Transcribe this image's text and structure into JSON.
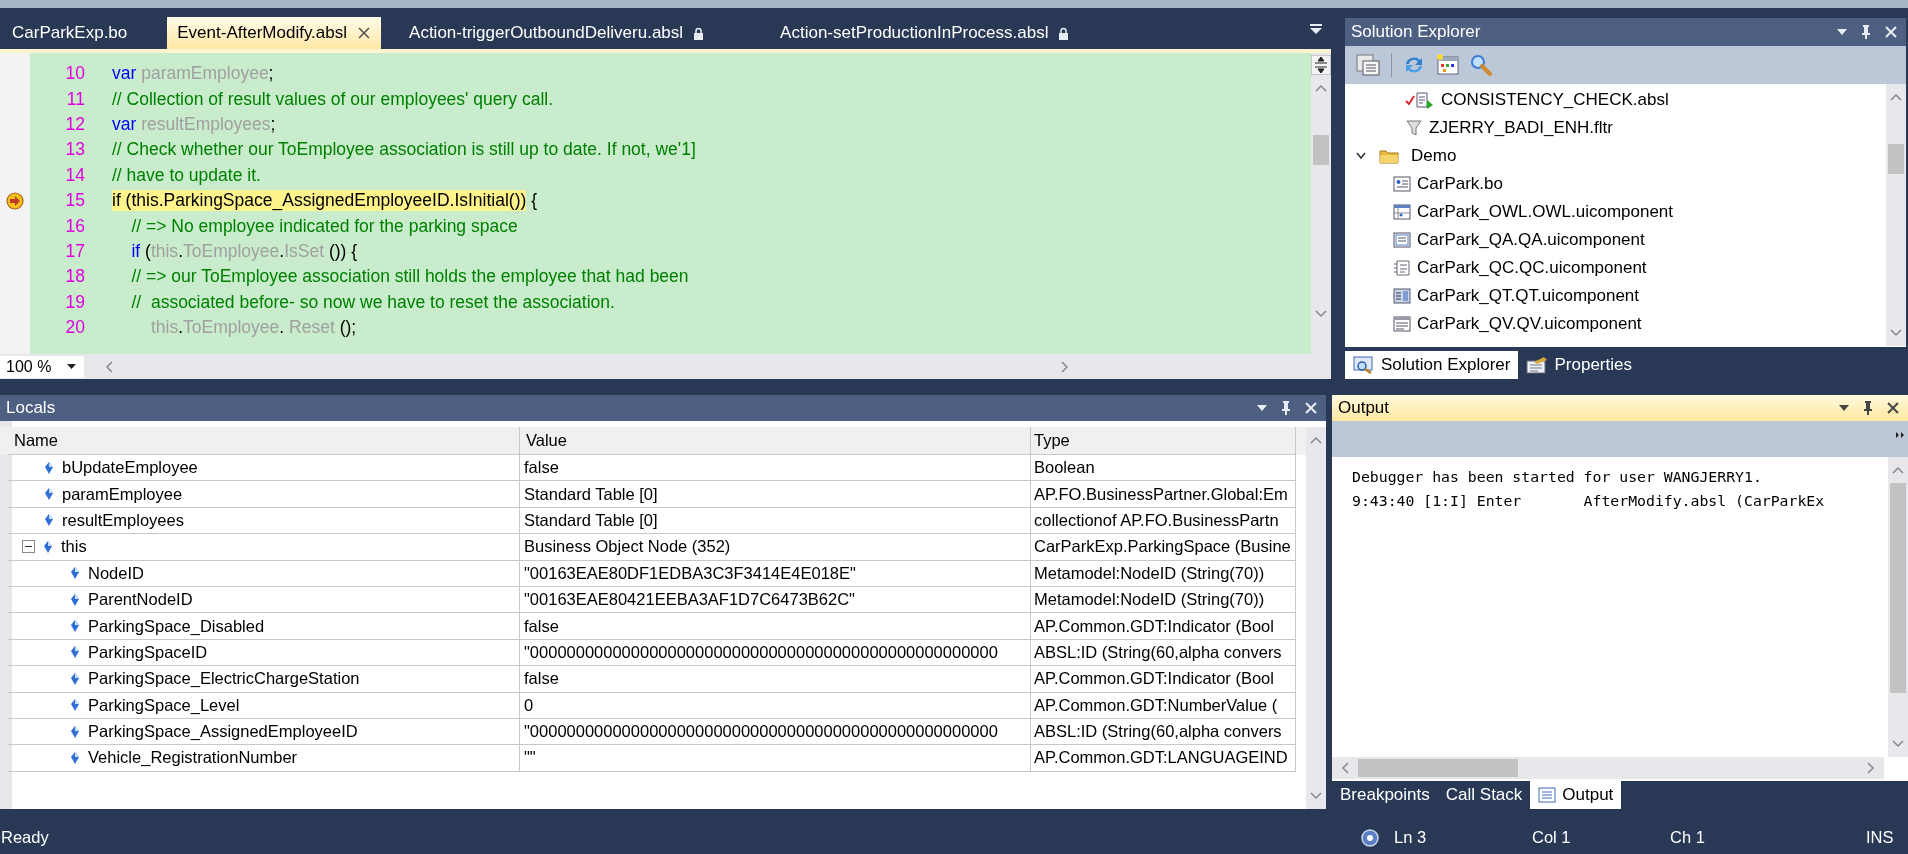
{
  "editor": {
    "tabs": [
      {
        "label": "CarParkExp.bo",
        "selected": false,
        "locked": false,
        "closable": false
      },
      {
        "label": "Event-AfterModify.absl",
        "selected": true,
        "locked": false,
        "closable": true
      },
      {
        "label": "Action-triggerOutboundDeliveru.absl",
        "selected": false,
        "locked": true,
        "closable": false
      },
      {
        "label": "Action-setProductionInProcess.absl",
        "selected": false,
        "locked": true,
        "closable": false
      }
    ],
    "lines": [
      {
        "number": "10",
        "current": false,
        "tokens": [
          {
            "kind": "keyword",
            "text": "var "
          },
          {
            "kind": "ident",
            "text": "paramEmployee"
          },
          {
            "kind": "plain",
            "text": ";"
          }
        ]
      },
      {
        "number": "11",
        "current": false,
        "tokens": [
          {
            "kind": "comment",
            "text": "// Collection of result values of our employees' query call."
          }
        ]
      },
      {
        "number": "12",
        "current": false,
        "tokens": [
          {
            "kind": "keyword",
            "text": "var "
          },
          {
            "kind": "ident",
            "text": "resultEmployees"
          },
          {
            "kind": "plain",
            "text": ";"
          }
        ]
      },
      {
        "number": "13",
        "current": false,
        "tokens": [
          {
            "kind": "comment",
            "text": "// Check whether our ToEmployee association is still up to date. If not, we'1]"
          }
        ]
      },
      {
        "number": "14",
        "current": false,
        "tokens": [
          {
            "kind": "comment",
            "text": "// have to update it."
          }
        ]
      },
      {
        "number": "15",
        "current": true,
        "tokens": [
          {
            "kind": "plain",
            "text": "if (this.ParkingSpace_AssignedEmployeeID.IsInitial())"
          }
        ],
        "tail": " {"
      },
      {
        "number": "16",
        "current": false,
        "tokens": [
          {
            "kind": "comment",
            "text": "    // => No employee indicated for the parking space"
          }
        ]
      },
      {
        "number": "17",
        "current": false,
        "tokens": [
          {
            "kind": "keyword",
            "text": "    if "
          },
          {
            "kind": "plain",
            "text": "("
          },
          {
            "kind": "ident",
            "text": "this"
          },
          {
            "kind": "plain",
            "text": "."
          },
          {
            "kind": "ident",
            "text": "ToEmployee"
          },
          {
            "kind": "plain",
            "text": "."
          },
          {
            "kind": "ident",
            "text": "IsSet"
          },
          {
            "kind": "plain",
            "text": " ()) {"
          }
        ]
      },
      {
        "number": "18",
        "current": false,
        "tokens": [
          {
            "kind": "comment",
            "text": "    // => our ToEmployee association still holds the employee that had been"
          }
        ]
      },
      {
        "number": "19",
        "current": false,
        "tokens": [
          {
            "kind": "comment",
            "text": "    //  associated before- so now we have to reset the association."
          }
        ]
      },
      {
        "number": "20",
        "current": false,
        "tokens": [
          {
            "kind": "ident",
            "text": "        this"
          },
          {
            "kind": "plain",
            "text": "."
          },
          {
            "kind": "ident",
            "text": "ToEmployee"
          },
          {
            "kind": "plain",
            "text": ". "
          },
          {
            "kind": "ident",
            "text": "Reset"
          },
          {
            "kind": "plain",
            "text": " ();"
          }
        ]
      }
    ],
    "zoom": "100 %"
  },
  "solution_explorer": {
    "title": "Solution Explorer",
    "tree": [
      {
        "label": "CONSISTENCY_CHECK.absl",
        "kind": "checked-script"
      },
      {
        "label": "ZJERRY_BADI_ENH.fltr",
        "kind": "filter"
      },
      {
        "label": "Demo",
        "kind": "folder",
        "expanded": true,
        "children": [
          {
            "label": "CarPark.bo",
            "kind": "bo"
          },
          {
            "label": "CarPark_OWL.OWL.uicomponent",
            "kind": "owl"
          },
          {
            "label": "CarPark_QA.QA.uicomponent",
            "kind": "qa"
          },
          {
            "label": "CarPark_QC.QC.uicomponent",
            "kind": "qc"
          },
          {
            "label": "CarPark_QT.QT.uicomponent",
            "kind": "qt"
          },
          {
            "label": "CarPark_QV.QV.uicomponent",
            "kind": "qv"
          }
        ]
      }
    ],
    "tabs": [
      {
        "label": "Solution Explorer",
        "selected": true,
        "kind": "solution"
      },
      {
        "label": "Properties",
        "selected": false,
        "kind": "properties"
      }
    ]
  },
  "locals": {
    "title": "Locals",
    "columns": [
      "Name",
      "Value",
      "Type"
    ],
    "rows": [
      {
        "name": "bUpdateEmployee",
        "value": "false",
        "type": "Boolean"
      },
      {
        "name": "paramEmployee",
        "value": "Standard Table [0]",
        "type": "AP.FO.BusinessPartner.Global:Em"
      },
      {
        "name": "resultEmployees",
        "value": "Standard Table [0]",
        "type": "collectionof AP.FO.BusinessPartn"
      },
      {
        "name": "this",
        "value": "Business Object Node (352)",
        "type": "CarParkExp.ParkingSpace (Busine",
        "expanded": true,
        "children": [
          {
            "name": "NodeID",
            "value": "\"00163EAE80DF1EDBA3C3F3414E4E018E\"",
            "type": "Metamodel:NodeID (String(70))"
          },
          {
            "name": "ParentNodeID",
            "value": "\"00163EAE80421EEBA3AF1D7C6473B62C\"",
            "type": "Metamodel:NodeID (String(70))"
          },
          {
            "name": "ParkingSpace_Disabled",
            "value": "false",
            "type": "AP.Common.GDT:Indicator (Bool"
          },
          {
            "name": "ParkingSpaceID",
            "value": "\"000000000000000000000000000000000000000000000000000",
            "type": "ABSL:ID (String(60,alpha convers"
          },
          {
            "name": "ParkingSpace_ElectricChargeStation",
            "value": "false",
            "type": "AP.Common.GDT:Indicator (Bool"
          },
          {
            "name": "ParkingSpace_Level",
            "value": "0",
            "type": "AP.Common.GDT:NumberValue ("
          },
          {
            "name": "ParkingSpace_AssignedEmployeeID",
            "value": "\"000000000000000000000000000000000000000000000000000",
            "type": "ABSL:ID (String(60,alpha convers"
          },
          {
            "name": "Vehicle_RegistrationNumber",
            "value": "\"\"",
            "type": "AP.Common.GDT:LANGUAGEIND"
          }
        ]
      }
    ]
  },
  "output": {
    "title": "Output",
    "lines": [
      "Debugger has been started for user WANGJERRY1.",
      "9:43:40 [1:I] Enter       AfterModify.absl (CarParkEx"
    ],
    "tabs": [
      {
        "label": "Breakpoints",
        "selected": false
      },
      {
        "label": "Call Stack",
        "selected": false
      },
      {
        "label": "Output",
        "selected": true
      }
    ]
  },
  "status_bar": {
    "message": "Ready",
    "line": "Ln 3",
    "column": "Col 1",
    "char": "Ch 1",
    "mode": "INS"
  }
}
